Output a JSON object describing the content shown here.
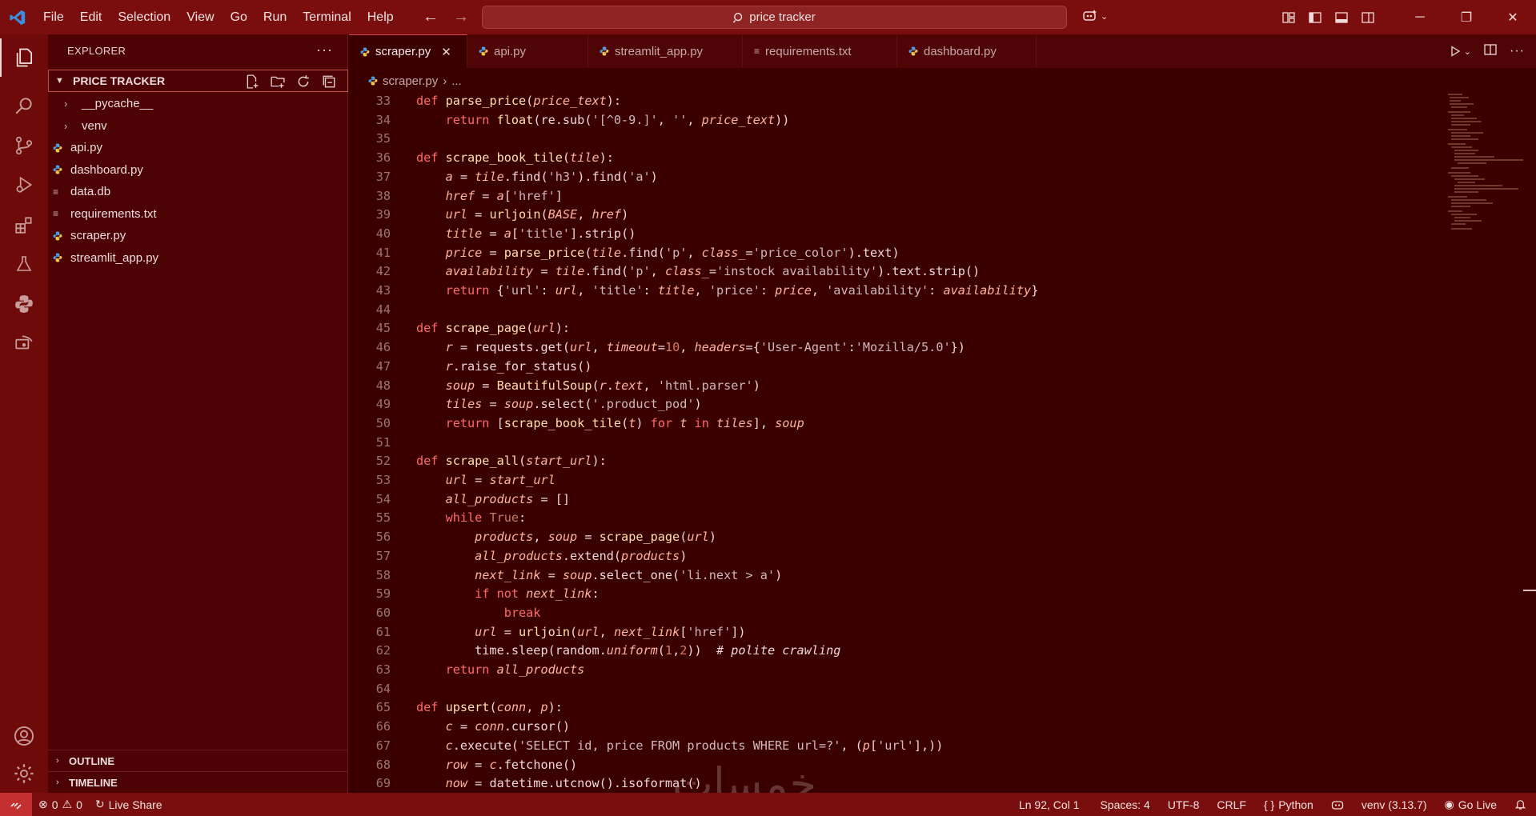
{
  "titlebar": {
    "menu": [
      "File",
      "Edit",
      "Selection",
      "View",
      "Go",
      "Run",
      "Terminal",
      "Help"
    ],
    "search": "price tracker"
  },
  "sidebar": {
    "title": "EXPLORER",
    "more": "···",
    "section": "PRICE TRACKER",
    "items": [
      {
        "label": "__pycache__",
        "type": "folder"
      },
      {
        "label": "venv",
        "type": "folder"
      },
      {
        "label": "api.py",
        "type": "python"
      },
      {
        "label": "dashboard.py",
        "type": "python"
      },
      {
        "label": "data.db",
        "type": "text"
      },
      {
        "label": "requirements.txt",
        "type": "text"
      },
      {
        "label": "scraper.py",
        "type": "python"
      },
      {
        "label": "streamlit_app.py",
        "type": "python"
      }
    ],
    "outline": "OUTLINE",
    "timeline": "TIMELINE"
  },
  "tabs": [
    {
      "label": "scraper.py",
      "type": "python",
      "active": true
    },
    {
      "label": "api.py",
      "type": "python"
    },
    {
      "label": "streamlit_app.py",
      "type": "python"
    },
    {
      "label": "requirements.txt",
      "type": "text"
    },
    {
      "label": "dashboard.py",
      "type": "python"
    }
  ],
  "breadcrumb": {
    "file": "scraper.py",
    "rest": "..."
  },
  "code": [
    {
      "n": "33",
      "t": [
        [
          "kw",
          "def "
        ],
        [
          "fn",
          "parse_price"
        ],
        [
          "plain",
          "("
        ],
        [
          "var",
          "price_text"
        ],
        [
          "plain",
          "):"
        ]
      ]
    },
    {
      "n": "34",
      "t": [
        [
          "kw",
          "    return "
        ],
        [
          "fn",
          "float"
        ],
        [
          "plain",
          "(re.sub("
        ],
        [
          "str",
          "'[^0-9.]'"
        ],
        [
          "plain",
          ", "
        ],
        [
          "str",
          "''"
        ],
        [
          "plain",
          ", "
        ],
        [
          "var",
          "price_text"
        ],
        [
          "plain",
          "))"
        ]
      ]
    },
    {
      "n": "35",
      "t": []
    },
    {
      "n": "36",
      "t": [
        [
          "kw",
          "def "
        ],
        [
          "fn",
          "scrape_book_tile"
        ],
        [
          "plain",
          "("
        ],
        [
          "var",
          "tile"
        ],
        [
          "plain",
          "):"
        ]
      ]
    },
    {
      "n": "37",
      "t": [
        [
          "var",
          "    a"
        ],
        [
          "plain",
          " = "
        ],
        [
          "var",
          "tile"
        ],
        [
          "plain",
          ".find("
        ],
        [
          "str",
          "'h3'"
        ],
        [
          "plain",
          ").find("
        ],
        [
          "str",
          "'a'"
        ],
        [
          "plain",
          ")"
        ]
      ]
    },
    {
      "n": "38",
      "t": [
        [
          "var",
          "    href"
        ],
        [
          "plain",
          " = "
        ],
        [
          "var",
          "a"
        ],
        [
          "plain",
          "["
        ],
        [
          "str",
          "'href'"
        ],
        [
          "plain",
          "]"
        ]
      ]
    },
    {
      "n": "39",
      "t": [
        [
          "var",
          "    url"
        ],
        [
          "plain",
          " = "
        ],
        [
          "fn",
          "urljoin"
        ],
        [
          "plain",
          "("
        ],
        [
          "var",
          "BASE"
        ],
        [
          "plain",
          ", "
        ],
        [
          "var",
          "href"
        ],
        [
          "plain",
          ")"
        ]
      ]
    },
    {
      "n": "40",
      "t": [
        [
          "var",
          "    title"
        ],
        [
          "plain",
          " = "
        ],
        [
          "var",
          "a"
        ],
        [
          "plain",
          "["
        ],
        [
          "str",
          "'title'"
        ],
        [
          "plain",
          "].strip()"
        ]
      ]
    },
    {
      "n": "41",
      "t": [
        [
          "var",
          "    price"
        ],
        [
          "plain",
          " = "
        ],
        [
          "fn",
          "parse_price"
        ],
        [
          "plain",
          "("
        ],
        [
          "var",
          "tile"
        ],
        [
          "plain",
          ".find("
        ],
        [
          "str",
          "'p'"
        ],
        [
          "plain",
          ", "
        ],
        [
          "var",
          "class_"
        ],
        [
          "plain",
          "="
        ],
        [
          "str",
          "'price_color'"
        ],
        [
          "plain",
          ").text)"
        ]
      ]
    },
    {
      "n": "42",
      "t": [
        [
          "var",
          "    availability"
        ],
        [
          "plain",
          " = "
        ],
        [
          "var",
          "tile"
        ],
        [
          "plain",
          ".find("
        ],
        [
          "str",
          "'p'"
        ],
        [
          "plain",
          ", "
        ],
        [
          "var",
          "class_"
        ],
        [
          "plain",
          "="
        ],
        [
          "str",
          "'instock availability'"
        ],
        [
          "plain",
          ").text.strip()"
        ]
      ]
    },
    {
      "n": "43",
      "t": [
        [
          "kw",
          "    return "
        ],
        [
          "plain",
          "{"
        ],
        [
          "str",
          "'url'"
        ],
        [
          "plain",
          ": "
        ],
        [
          "var",
          "url"
        ],
        [
          "plain",
          ", "
        ],
        [
          "str",
          "'title'"
        ],
        [
          "plain",
          ": "
        ],
        [
          "var",
          "title"
        ],
        [
          "plain",
          ", "
        ],
        [
          "str",
          "'price'"
        ],
        [
          "plain",
          ": "
        ],
        [
          "var",
          "price"
        ],
        [
          "plain",
          ", "
        ],
        [
          "str",
          "'availability'"
        ],
        [
          "plain",
          ": "
        ],
        [
          "var",
          "availability"
        ],
        [
          "plain",
          "}"
        ]
      ]
    },
    {
      "n": "44",
      "t": []
    },
    {
      "n": "45",
      "t": [
        [
          "kw",
          "def "
        ],
        [
          "fn",
          "scrape_page"
        ],
        [
          "plain",
          "("
        ],
        [
          "var",
          "url"
        ],
        [
          "plain",
          "):"
        ]
      ]
    },
    {
      "n": "46",
      "t": [
        [
          "var",
          "    r"
        ],
        [
          "plain",
          " = requests.get("
        ],
        [
          "var",
          "url"
        ],
        [
          "plain",
          ", "
        ],
        [
          "var",
          "timeout"
        ],
        [
          "plain",
          "="
        ],
        [
          "num",
          "10"
        ],
        [
          "plain",
          ", "
        ],
        [
          "var",
          "headers"
        ],
        [
          "plain",
          "={"
        ],
        [
          "str",
          "'User-Agent'"
        ],
        [
          "plain",
          ":"
        ],
        [
          "str",
          "'Mozilla/5.0'"
        ],
        [
          "plain",
          "})"
        ]
      ]
    },
    {
      "n": "47",
      "t": [
        [
          "var",
          "    r"
        ],
        [
          "plain",
          ".raise_for_status()"
        ]
      ]
    },
    {
      "n": "48",
      "t": [
        [
          "var",
          "    soup"
        ],
        [
          "plain",
          " = "
        ],
        [
          "fn",
          "BeautifulSoup"
        ],
        [
          "plain",
          "("
        ],
        [
          "var",
          "r"
        ],
        [
          "plain",
          "."
        ],
        [
          "var",
          "text"
        ],
        [
          "plain",
          ", "
        ],
        [
          "str",
          "'html.parser'"
        ],
        [
          "plain",
          ")"
        ]
      ]
    },
    {
      "n": "49",
      "t": [
        [
          "var",
          "    tiles"
        ],
        [
          "plain",
          " = "
        ],
        [
          "var",
          "soup"
        ],
        [
          "plain",
          ".select("
        ],
        [
          "str",
          "'.product_pod'"
        ],
        [
          "plain",
          ")"
        ]
      ]
    },
    {
      "n": "50",
      "t": [
        [
          "kw",
          "    return "
        ],
        [
          "plain",
          "["
        ],
        [
          "fn",
          "scrape_book_tile"
        ],
        [
          "plain",
          "("
        ],
        [
          "var",
          "t"
        ],
        [
          "plain",
          ") "
        ],
        [
          "kw",
          "for "
        ],
        [
          "var",
          "t"
        ],
        [
          "kw",
          " in "
        ],
        [
          "var",
          "tiles"
        ],
        [
          "plain",
          "], "
        ],
        [
          "var",
          "soup"
        ]
      ]
    },
    {
      "n": "51",
      "t": []
    },
    {
      "n": "52",
      "t": [
        [
          "kw",
          "def "
        ],
        [
          "fn",
          "scrape_all"
        ],
        [
          "plain",
          "("
        ],
        [
          "var",
          "start_url"
        ],
        [
          "plain",
          "):"
        ]
      ]
    },
    {
      "n": "53",
      "t": [
        [
          "var",
          "    url"
        ],
        [
          "plain",
          " = "
        ],
        [
          "var",
          "start_url"
        ]
      ]
    },
    {
      "n": "54",
      "t": [
        [
          "var",
          "    all_products"
        ],
        [
          "plain",
          " = []"
        ]
      ]
    },
    {
      "n": "55",
      "t": [
        [
          "kw",
          "    while "
        ],
        [
          "bool",
          "True"
        ],
        [
          "plain",
          ":"
        ]
      ]
    },
    {
      "n": "56",
      "t": [
        [
          "var",
          "        products"
        ],
        [
          "plain",
          ", "
        ],
        [
          "var",
          "soup"
        ],
        [
          "plain",
          " = "
        ],
        [
          "fn",
          "scrape_page"
        ],
        [
          "plain",
          "("
        ],
        [
          "var",
          "url"
        ],
        [
          "plain",
          ")"
        ]
      ]
    },
    {
      "n": "57",
      "t": [
        [
          "var",
          "        all_products"
        ],
        [
          "plain",
          ".extend("
        ],
        [
          "var",
          "products"
        ],
        [
          "plain",
          ")"
        ]
      ]
    },
    {
      "n": "58",
      "t": [
        [
          "var",
          "        next_link"
        ],
        [
          "plain",
          " = "
        ],
        [
          "var",
          "soup"
        ],
        [
          "plain",
          ".select_one("
        ],
        [
          "str",
          "'li.next > a'"
        ],
        [
          "plain",
          ")"
        ]
      ]
    },
    {
      "n": "59",
      "t": [
        [
          "kw",
          "        if not "
        ],
        [
          "var",
          "next_link"
        ],
        [
          "plain",
          ":"
        ]
      ]
    },
    {
      "n": "60",
      "t": [
        [
          "kw",
          "            break"
        ]
      ]
    },
    {
      "n": "61",
      "t": [
        [
          "var",
          "        url"
        ],
        [
          "plain",
          " = "
        ],
        [
          "fn",
          "urljoin"
        ],
        [
          "plain",
          "("
        ],
        [
          "var",
          "url"
        ],
        [
          "plain",
          ", "
        ],
        [
          "var",
          "next_link"
        ],
        [
          "plain",
          "["
        ],
        [
          "str",
          "'href'"
        ],
        [
          "plain",
          "])"
        ]
      ]
    },
    {
      "n": "62",
      "t": [
        [
          "plain",
          "        time.sleep(random."
        ],
        [
          "var",
          "uniform"
        ],
        [
          "plain",
          "("
        ],
        [
          "num",
          "1"
        ],
        [
          "plain",
          ","
        ],
        [
          "num",
          "2"
        ],
        [
          "plain",
          "))  "
        ],
        [
          "cm",
          "# polite crawling"
        ]
      ]
    },
    {
      "n": "63",
      "t": [
        [
          "kw",
          "    return "
        ],
        [
          "var",
          "all_products"
        ]
      ]
    },
    {
      "n": "64",
      "t": []
    },
    {
      "n": "65",
      "t": [
        [
          "kw",
          "def "
        ],
        [
          "fn",
          "upsert"
        ],
        [
          "plain",
          "("
        ],
        [
          "var",
          "conn"
        ],
        [
          "plain",
          ", "
        ],
        [
          "var",
          "p"
        ],
        [
          "plain",
          "):"
        ]
      ]
    },
    {
      "n": "66",
      "t": [
        [
          "var",
          "    c"
        ],
        [
          "plain",
          " = "
        ],
        [
          "var",
          "conn"
        ],
        [
          "plain",
          ".cursor()"
        ]
      ]
    },
    {
      "n": "67",
      "t": [
        [
          "var",
          "    c"
        ],
        [
          "plain",
          ".execute("
        ],
        [
          "str",
          "'SELECT id, price FROM products WHERE url=?'"
        ],
        [
          "plain",
          ", ("
        ],
        [
          "var",
          "p"
        ],
        [
          "plain",
          "["
        ],
        [
          "str",
          "'url'"
        ],
        [
          "plain",
          "],))"
        ]
      ]
    },
    {
      "n": "68",
      "t": [
        [
          "var",
          "    row"
        ],
        [
          "plain",
          " = "
        ],
        [
          "var",
          "c"
        ],
        [
          "plain",
          ".fetchone()"
        ]
      ]
    },
    {
      "n": "69",
      "t": [
        [
          "var",
          "    now"
        ],
        [
          "plain",
          " = datetime.utcnow().isoformat()"
        ]
      ]
    }
  ],
  "status": {
    "errors": "0",
    "warnings": "0",
    "live_share": "Live Share",
    "position": "Ln 92, Col 1",
    "spaces": "Spaces: 4",
    "encoding": "UTF-8",
    "eol": "CRLF",
    "language": "Python",
    "venv": "venv (3.13.7)",
    "go_live": "Go Live"
  },
  "watermark": "خمسات"
}
